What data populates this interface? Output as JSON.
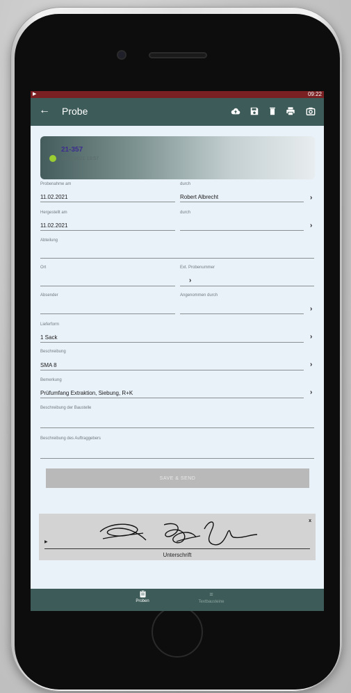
{
  "status_bar": {
    "time": "09:22",
    "media_icon": "play-icon"
  },
  "toolbar": {
    "title": "Probe",
    "actions": [
      "cloud-upload-icon",
      "save-icon",
      "delete-icon",
      "print-icon",
      "camera-icon"
    ]
  },
  "header_card": {
    "number": "21-357",
    "date": "11.02.2021 13:57"
  },
  "form": {
    "probenahme_label": "Probenahme am",
    "probenahme_value": "11.02.2021",
    "durch1_label": "durch",
    "durch1_value": "Robert Albrecht",
    "hergestellt_label": "Hergestellt am",
    "hergestellt_value": "11.02.2021",
    "durch2_label": "durch",
    "durch2_value": "",
    "abteilung_label": "Abteilung",
    "abteilung_value": "",
    "ort_label": "Ort",
    "ort_value": "",
    "ext_label": "Ext. Probenummer",
    "ext_value": "",
    "absender_label": "Absender",
    "absender_value": "",
    "angenommen_label": "Angenommen durch",
    "angenommen_value": "",
    "lieferform_label": "Lieferform",
    "lieferform_value": "1 Sack",
    "beschreibung_label": "Beschreibung",
    "beschreibung_value": "SMA 8",
    "bemerkung_label": "Bemerkung",
    "bemerkung_value": "Prüfumfang Extraktion, Siebung, R+K",
    "baustelle_label": "Beschreibung der Baustelle",
    "baustelle_value": "",
    "auftraggeber_label": "Beschreibung des Auftraggebers",
    "auftraggeber_value": ""
  },
  "save_button": "SAVE & SEND",
  "signature": {
    "caption": "Unterschrift",
    "clear": "x"
  },
  "bottom_nav": {
    "tab1": "Proben",
    "tab2": "Textbausteine"
  },
  "colors": {
    "toolbar": "#3d5b58",
    "status_bar": "#7a1f22",
    "screen_bg": "#e9f1f9"
  }
}
